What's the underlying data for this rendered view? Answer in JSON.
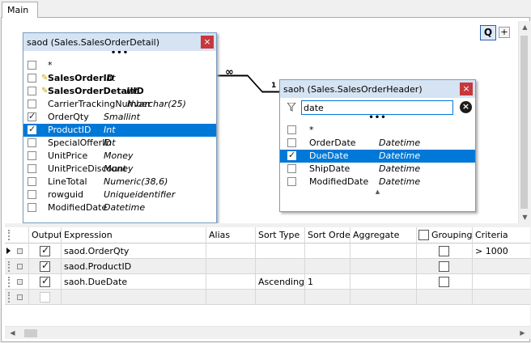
{
  "tabs": {
    "main": "Main"
  },
  "diagram": {
    "query_button": "Q",
    "add_button": "+",
    "link": {
      "left_cardinality": "∞",
      "right_cardinality": "1"
    }
  },
  "table_saod": {
    "title": "saod (Sales.SalesOrderDetail)",
    "close": "×",
    "dots": "•••",
    "rows": [
      {
        "name": "*",
        "type": "",
        "checked": false,
        "key": false,
        "bold": false,
        "selected": false
      },
      {
        "name": "SalesOrderID",
        "type": "Int",
        "checked": false,
        "key": true,
        "bold": true,
        "selected": false
      },
      {
        "name": "SalesOrderDetailID",
        "type": "Int",
        "checked": false,
        "key": true,
        "bold": true,
        "selected": false
      },
      {
        "name": "CarrierTrackingNumber",
        "type": "Nvarchar(25)",
        "checked": false,
        "key": false,
        "bold": false,
        "selected": false
      },
      {
        "name": "OrderQty",
        "type": "Smallint",
        "checked": true,
        "key": false,
        "bold": false,
        "selected": false
      },
      {
        "name": "ProductID",
        "type": "Int",
        "checked": true,
        "key": false,
        "bold": false,
        "selected": true
      },
      {
        "name": "SpecialOfferID",
        "type": "Int",
        "checked": false,
        "key": false,
        "bold": false,
        "selected": false
      },
      {
        "name": "UnitPrice",
        "type": "Money",
        "checked": false,
        "key": false,
        "bold": false,
        "selected": false
      },
      {
        "name": "UnitPriceDiscount",
        "type": "Money",
        "checked": false,
        "key": false,
        "bold": false,
        "selected": false
      },
      {
        "name": "LineTotal",
        "type": "Numeric(38,6)",
        "checked": false,
        "key": false,
        "bold": false,
        "selected": false
      },
      {
        "name": "rowguid",
        "type": "Uniqueidentifier",
        "checked": false,
        "key": false,
        "bold": false,
        "selected": false
      },
      {
        "name": "ModifiedDate",
        "type": "Datetime",
        "checked": false,
        "key": false,
        "bold": false,
        "selected": false
      }
    ]
  },
  "table_saoh": {
    "title": "saoh (Sales.SalesOrderHeader)",
    "close": "×",
    "filter_value": "date",
    "dots": "•••",
    "more_arrow": "▲",
    "rows": [
      {
        "name": "*",
        "type": "",
        "checked": false,
        "selected": false
      },
      {
        "name": "OrderDate",
        "type": "Datetime",
        "checked": false,
        "selected": false
      },
      {
        "name": "DueDate",
        "type": "Datetime",
        "checked": true,
        "selected": true
      },
      {
        "name": "ShipDate",
        "type": "Datetime",
        "checked": false,
        "selected": false
      },
      {
        "name": "ModifiedDate",
        "type": "Datetime",
        "checked": false,
        "selected": false
      }
    ]
  },
  "grid": {
    "headers": {
      "output": "Output",
      "expression": "Expression",
      "alias": "Alias",
      "sort_type": "Sort Type",
      "sort_order": "Sort Order",
      "aggregate": "Aggregate",
      "grouping": "Grouping",
      "criteria": "Criteria"
    },
    "rows": [
      {
        "output": true,
        "expression": "saod.OrderQty",
        "alias": "",
        "sort_type": "",
        "sort_order": "",
        "aggregate": "",
        "grouping": false,
        "criteria": "> 1000"
      },
      {
        "output": true,
        "expression": "saod.ProductID",
        "alias": "",
        "sort_type": "",
        "sort_order": "",
        "aggregate": "",
        "grouping": false,
        "criteria": ""
      },
      {
        "output": true,
        "expression": "saoh.DueDate",
        "alias": "",
        "sort_type": "Ascending",
        "sort_order": "1",
        "aggregate": "",
        "grouping": false,
        "criteria": ""
      }
    ]
  },
  "scroll_arrows": {
    "up": "▲",
    "down": "▼",
    "left": "◀",
    "right": "▶"
  }
}
